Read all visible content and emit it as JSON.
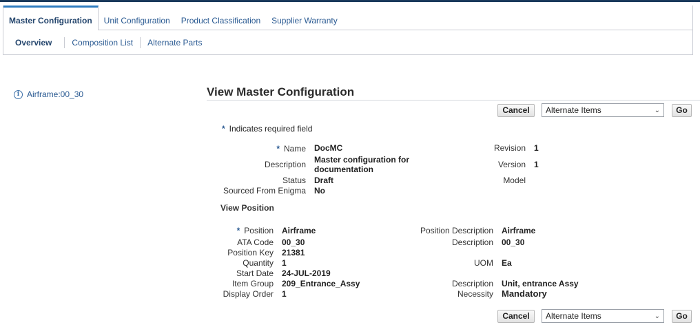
{
  "tabs": [
    "Master Configuration",
    "Unit Configuration",
    "Product Classification",
    "Supplier Warranty"
  ],
  "subtabs": [
    "Overview",
    "Composition List",
    "Alternate Parts"
  ],
  "tree": {
    "item": "Airframe:00_30",
    "icon": "info-icon"
  },
  "page_title": "View Master Configuration",
  "buttons": {
    "cancel": "Cancel",
    "select_value": "Alternate Items",
    "go": "Go"
  },
  "required_note": "Indicates required field",
  "header": {
    "name_label": "Name",
    "name": "DocMC",
    "description_label": "Description",
    "description": "Master configuration for documentation",
    "status_label": "Status",
    "status": "Draft",
    "sourced_label": "Sourced From Enigma",
    "sourced": "No",
    "revision_label": "Revision",
    "revision": "1",
    "version_label": "Version",
    "version": "1",
    "model_label": "Model",
    "model": ""
  },
  "position_section": "View Position",
  "position": {
    "position_label": "Position",
    "position": "Airframe",
    "ata_label": "ATA Code",
    "ata": "00_30",
    "key_label": "Position Key",
    "key": "21381",
    "quantity_label": "Quantity",
    "quantity": "1",
    "start_label": "Start Date",
    "start": "24-JUL-2019",
    "group_label": "Item Group",
    "group": "209_Entrance_Assy",
    "order_label": "Display Order",
    "order": "1",
    "pos_desc_label": "Position Description",
    "pos_desc": "Airframe",
    "desc_label": "Description",
    "desc": "00_30",
    "uom_label": "UOM",
    "uom": "Ea",
    "group_desc_label": "Description",
    "group_desc": "Unit, entrance Assy",
    "necessity_label": "Necessity",
    "necessity": "Mandatory"
  },
  "colors": {
    "accent": "#2a5a92",
    "topbar": "#1a3a5c"
  }
}
